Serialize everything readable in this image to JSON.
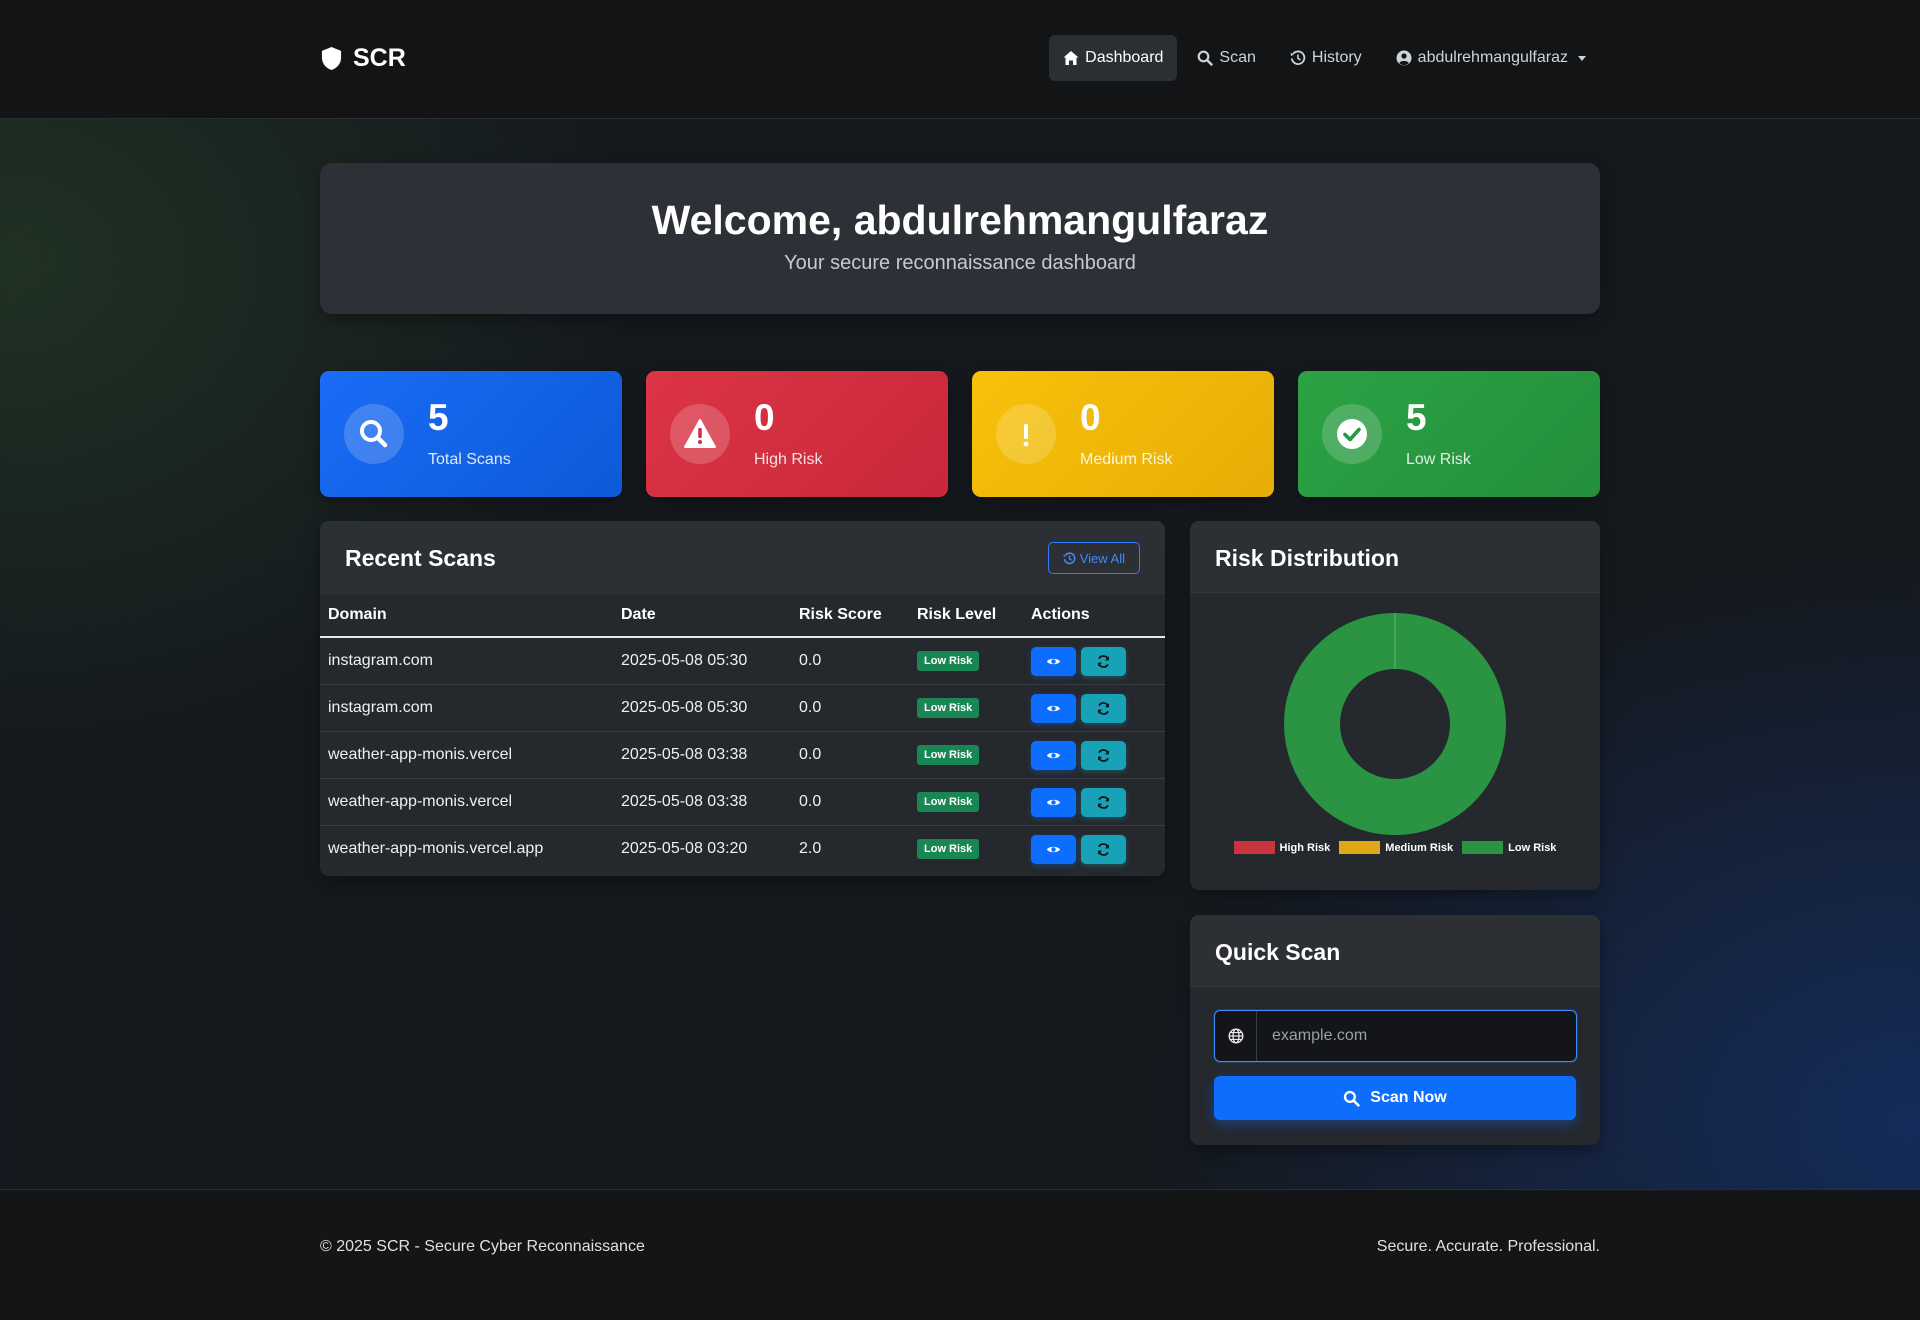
{
  "brand": {
    "name": "SCR",
    "icon": "shield-icon"
  },
  "nav": {
    "dashboard": "Dashboard",
    "scan": "Scan",
    "history": "History",
    "user": "abdulrehmangulfaraz"
  },
  "welcome": {
    "title": "Welcome, abdulrehmangulfaraz",
    "subtitle": "Your secure reconnaissance dashboard"
  },
  "stats": [
    {
      "value": "5",
      "label": "Total Scans",
      "icon": "search-icon",
      "color": "#0d6efd"
    },
    {
      "value": "0",
      "label": "High Risk",
      "icon": "warning-icon",
      "color": "#dc3545"
    },
    {
      "value": "0",
      "label": "Medium Risk",
      "icon": "exclamation-icon",
      "color": "#f5bb08"
    },
    {
      "value": "5",
      "label": "Low Risk",
      "icon": "check-circle-icon",
      "color": "#28a745"
    }
  ],
  "recent": {
    "title": "Recent Scans",
    "view_all": "View All",
    "columns": [
      "Domain",
      "Date",
      "Risk Score",
      "Risk Level",
      "Actions"
    ],
    "rows": [
      {
        "domain": "instagram.com",
        "date": "2025-05-08 05:30",
        "score": "0.0",
        "level": "Low Risk"
      },
      {
        "domain": "instagram.com",
        "date": "2025-05-08 05:30",
        "score": "0.0",
        "level": "Low Risk"
      },
      {
        "domain": "weather-app-monis.vercel",
        "date": "2025-05-08 03:38",
        "score": "0.0",
        "level": "Low Risk"
      },
      {
        "domain": "weather-app-monis.vercel",
        "date": "2025-05-08 03:38",
        "score": "0.0",
        "level": "Low Risk"
      },
      {
        "domain": "weather-app-monis.vercel.app",
        "date": "2025-05-08 03:20",
        "score": "2.0",
        "level": "Low Risk"
      }
    ]
  },
  "distribution": {
    "title": "Risk Distribution",
    "legend": [
      "High Risk",
      "Medium Risk",
      "Low Risk"
    ]
  },
  "chart_data": {
    "type": "pie",
    "title": "Risk Distribution",
    "categories": [
      "High Risk",
      "Medium Risk",
      "Low Risk"
    ],
    "values": [
      0,
      0,
      5
    ],
    "colors": [
      "#c9343f",
      "#e0a817",
      "#2a9443"
    ],
    "donut": true,
    "legend": "bottom"
  },
  "quick": {
    "title": "Quick Scan",
    "placeholder": "example.com",
    "button": "Scan Now"
  },
  "footer": {
    "left": "© 2025 SCR - Secure Cyber Reconnaissance",
    "right": "Secure. Accurate. Professional."
  }
}
